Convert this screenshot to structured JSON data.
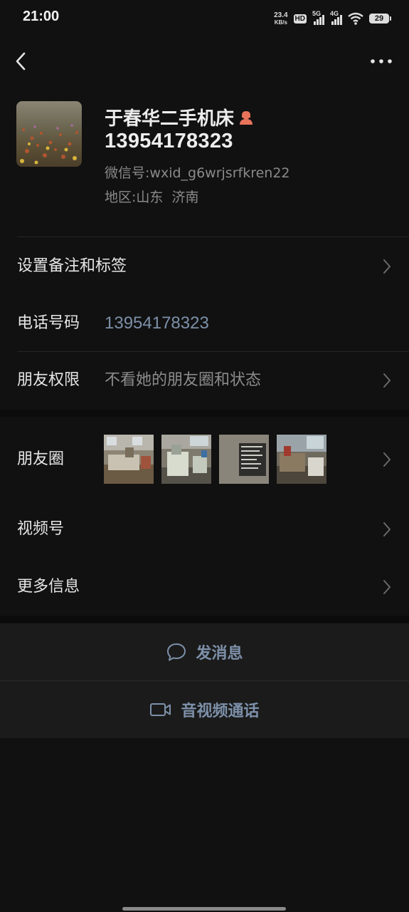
{
  "status_bar": {
    "time": "21:00",
    "net_speed_value": "23.4",
    "net_speed_unit": "KB/s",
    "hd_label": "HD",
    "signal_1_tag": "5G",
    "signal_2_tag": "4G",
    "battery_level": "29"
  },
  "profile": {
    "name": "于春华二手机床",
    "nickname": "13954178323",
    "wechat_id_label": "微信号:",
    "wechat_id": "wxid_g6wrjsrfkren22",
    "region_label": "地区:",
    "region": "山东  济南"
  },
  "rows": {
    "remarks_label": "设置备注和标签",
    "phone_label": "电话号码",
    "phone_value": "13954178323",
    "permission_label": "朋友权限",
    "permission_value": "不看她的朋友圈和状态",
    "moments_label": "朋友圈",
    "channels_label": "视频号",
    "more_info_label": "更多信息"
  },
  "actions": {
    "message_label": "发消息",
    "call_label": "音视频通话"
  },
  "colors": {
    "background": "#111111",
    "panel": "#1b1b1b",
    "link_blue": "#7d90a9",
    "secondary_text": "#8a8a8a",
    "gender_icon": "#e8735a"
  },
  "icons": [
    "back-arrow-icon",
    "more-dots-icon",
    "female-icon",
    "chevron-right-icon",
    "chat-bubble-icon",
    "video-camera-icon",
    "wifi-icon",
    "battery-icon"
  ]
}
